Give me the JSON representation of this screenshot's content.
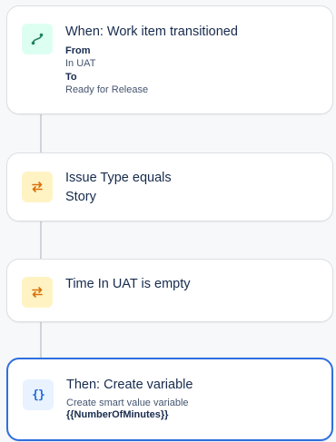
{
  "flow": {
    "trigger": {
      "title": "When: Work item transitioned",
      "from_label": "From",
      "from_value": "In UAT",
      "to_label": "To",
      "to_value": "Ready for Release",
      "icon": "branch-flow-icon",
      "color": "#1f845a"
    },
    "condition_issue_type": {
      "title": "Issue Type equals",
      "value": "Story",
      "icon": "swap-arrows-icon",
      "color": "#d97008"
    },
    "condition_time_in_uat": {
      "title": "Time In UAT is empty",
      "icon": "swap-arrows-icon",
      "color": "#d97008"
    },
    "action": {
      "title": "Then: Create variable",
      "description": "Create smart value variable",
      "variable": "{{NumberOfMinutes}}",
      "icon": "curly-braces-icon",
      "icon_glyph": "{}",
      "color": "#1d6bd6",
      "selected": true
    }
  }
}
